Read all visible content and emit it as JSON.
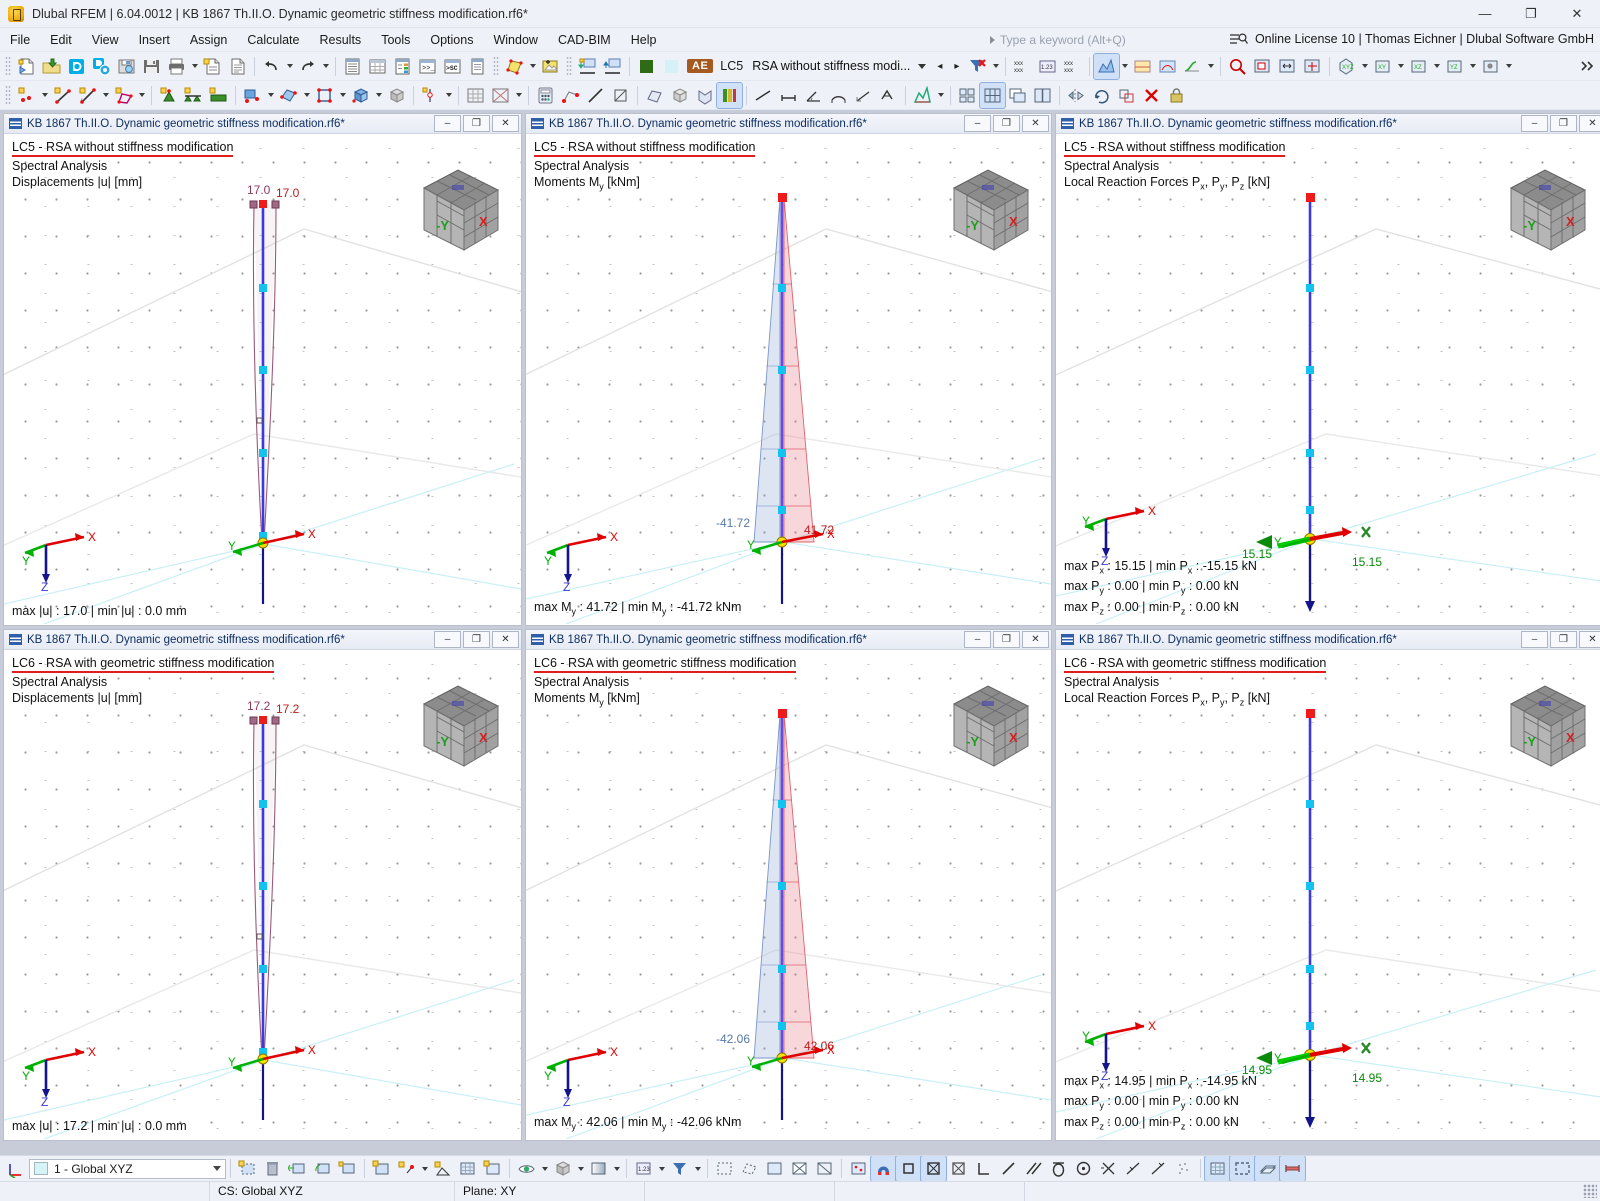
{
  "window": {
    "title": "Dlubal RFEM | 6.04.0012 | KB 1867 Th.II.O. Dynamic geometric stiffness modification.rf6*",
    "app_icon": "dlubal-logo-icon",
    "minimize": "—",
    "maximize": "❐",
    "close": "✕"
  },
  "menu": {
    "items": [
      {
        "label": "File"
      },
      {
        "label": "Edit"
      },
      {
        "label": "View"
      },
      {
        "label": "Insert"
      },
      {
        "label": "Assign"
      },
      {
        "label": "Calculate"
      },
      {
        "label": "Results"
      },
      {
        "label": "Tools"
      },
      {
        "label": "Options"
      },
      {
        "label": "Window"
      },
      {
        "label": "CAD-BIM"
      },
      {
        "label": "Help"
      }
    ],
    "search_placeholder": "Type a keyword (Alt+Q)",
    "license": "Online License 10 | Thomas Eichner | Dlubal Software GmbH"
  },
  "toolbar": {
    "load_case_badge": "AE",
    "load_case_id": "LC5",
    "load_case_name": "RSA without stiffness modi...",
    "prev_label": "◂",
    "next_label": "▸",
    "color_swatch": "#2e6b14",
    "color_swatch_2": "#d4f1f7"
  },
  "viewports": [
    {
      "id": "vp1",
      "title": "KB 1867 Th.II.O. Dynamic geometric stiffness modification.rf6*",
      "load_case": "LC5 - RSA without stiffness modification",
      "analysis": "Spectral Analysis",
      "result_type": "Displacements |u| [mm]",
      "result_kind": "displacement",
      "labels": [
        "17.0",
        "17.0"
      ],
      "footer_lines": [
        "max |u| : 17.0 | min |u| : 0.0 mm"
      ],
      "navcube": {
        "left": "-Y",
        "right": "X"
      },
      "tripod": {
        "x": "X",
        "y": "Y",
        "z": "Z"
      }
    },
    {
      "id": "vp2",
      "title": "KB 1867 Th.II.O. Dynamic geometric stiffness modification.rf6*",
      "load_case": "LC5 - RSA without stiffness modification",
      "analysis": "Spectral Analysis",
      "result_type": "Moments My [kNm]",
      "result_kind": "moment",
      "labels": [
        "-41.72",
        "41.72"
      ],
      "footer_lines": [
        "max My : 41.72 | min My : -41.72 kNm"
      ],
      "navcube": {
        "left": "-Y",
        "right": "X"
      },
      "tripod": {
        "x": "X",
        "y": "Y",
        "z": "Z"
      }
    },
    {
      "id": "vp3",
      "title": "KB 1867 Th.II.O. Dynamic geometric stiffness modification.rf6*",
      "load_case": "LC5 - RSA without stiffness modification",
      "analysis": "Spectral Analysis",
      "result_type": "Local Reaction Forces Px, Py, Pz [kN]",
      "result_kind": "reaction",
      "labels": [
        "15.15",
        "15.15"
      ],
      "footer_lines": [
        "max Px : 15.15 | min Px : -15.15 kN",
        "max Py : 0.00 | min Py : 0.00 kN",
        "max Pz : 0.00 | min Pz : 0.00 kN"
      ],
      "navcube": {
        "left": "-Y",
        "right": "X"
      },
      "tripod": {
        "x": "X",
        "y": "Y",
        "z": "Z"
      }
    },
    {
      "id": "vp4",
      "title": "KB 1867 Th.II.O. Dynamic geometric stiffness modification.rf6*",
      "load_case": "LC6 - RSA with geometric stiffness modification",
      "analysis": "Spectral Analysis",
      "result_type": "Displacements |u| [mm]",
      "result_kind": "displacement",
      "labels": [
        "17.2",
        "17.2"
      ],
      "footer_lines": [
        "max |u| : 17.2 | min |u| : 0.0 mm"
      ],
      "navcube": {
        "left": "-Y",
        "right": "X"
      },
      "tripod": {
        "x": "X",
        "y": "Y",
        "z": "Z"
      }
    },
    {
      "id": "vp5",
      "title": "KB 1867 Th.II.O. Dynamic geometric stiffness modification.rf6*",
      "load_case": "LC6 - RSA with geometric stiffness modification",
      "analysis": "Spectral Analysis",
      "result_type": "Moments My [kNm]",
      "result_kind": "moment",
      "labels": [
        "-42.06",
        "42.06"
      ],
      "footer_lines": [
        "max My : 42.06 | min My : -42.06 kNm"
      ],
      "navcube": {
        "left": "-Y",
        "right": "X"
      },
      "tripod": {
        "x": "X",
        "y": "Y",
        "z": "Z"
      }
    },
    {
      "id": "vp6",
      "title": "KB 1867 Th.II.O. Dynamic geometric stiffness modification.rf6*",
      "load_case": "LC6 - RSA with geometric stiffness modification",
      "analysis": "Spectral Analysis",
      "result_type": "Local Reaction Forces Px, Py, Pz [kN]",
      "result_kind": "reaction",
      "labels": [
        "14.95",
        "14.95"
      ],
      "footer_lines": [
        "max Px : 14.95 | min Px : -14.95 kN",
        "max Py : 0.00 | min Py : 0.00 kN",
        "max Pz : 0.00 | min Pz : 0.00 kN"
      ],
      "navcube": {
        "left": "-Y",
        "right": "X"
      },
      "tripod": {
        "x": "X",
        "y": "Y",
        "z": "Z"
      }
    }
  ],
  "mdi_buttons": {
    "minimize": "–",
    "restore": "❐",
    "close": "✕"
  },
  "statusbar": {
    "coordinate_system": "1 - Global XYZ",
    "cs_label": "CS: Global XYZ",
    "plane_label": "Plane: XY"
  },
  "colors": {
    "accent_red": "#e11d1d",
    "member_blue": "#3a3ae0",
    "node_cyan": "#12c3f0",
    "support_yellow": "#f5e000",
    "axis_x": "#e00000",
    "axis_y": "#00b000",
    "axis_z": "#1a1a8c",
    "deform_purple": "#9b5a78",
    "moment_red": "#e87a85",
    "moment_blue": "#8fa8d8",
    "title_blue": "#0e2f63"
  }
}
